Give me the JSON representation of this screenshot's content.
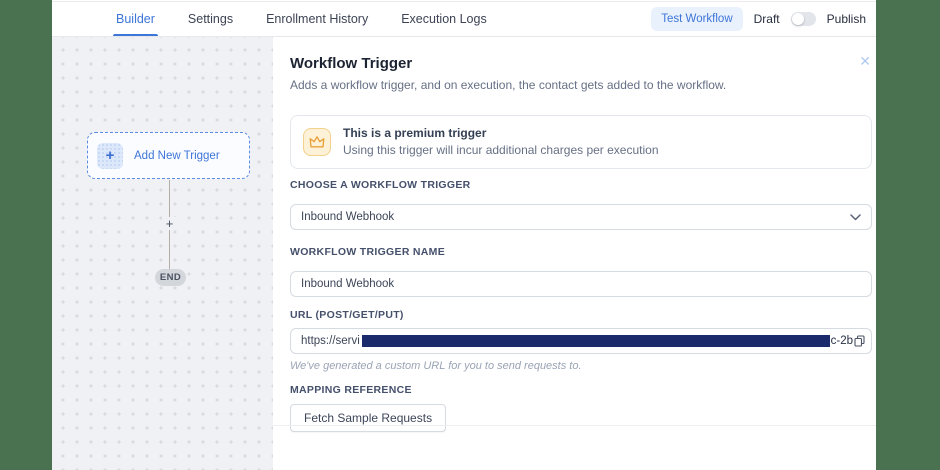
{
  "header": {
    "tabs": [
      {
        "label": "Builder"
      },
      {
        "label": "Settings"
      },
      {
        "label": "Enrollment History"
      },
      {
        "label": "Execution Logs"
      }
    ],
    "test_workflow_label": "Test Workflow",
    "draft_label": "Draft",
    "publish_label": "Publish",
    "toggle_state": "off"
  },
  "canvas": {
    "add_trigger_label": "Add New Trigger",
    "add_trigger_plus": "+",
    "connector_plus": "+",
    "end_label": "END"
  },
  "panel": {
    "title": "Workflow Trigger",
    "subtitle": "Adds a workflow trigger, and on execution, the contact gets added to the workflow.",
    "close_icon": "✕",
    "premium": {
      "icon": "crown-icon",
      "title": "This is a premium trigger",
      "subtitle": "Using this trigger will incur additional charges per execution"
    },
    "fields": {
      "trigger_label": "CHOOSE A WORKFLOW TRIGGER",
      "trigger_value": "Inbound Webhook",
      "name_label": "WORKFLOW TRIGGER NAME",
      "name_value": "Inbound Webhook",
      "url_label": "URL (POST/GET/PUT)",
      "url_prefix": "https://servi",
      "url_redacted": true,
      "url_suffix": "c-2b",
      "url_helper": "We've generated a custom URL for you to send requests to.",
      "mapping_label": "MAPPING REFERENCE",
      "fetch_button_label": "Fetch Sample Requests"
    }
  },
  "colors": {
    "accent_blue": "#3e75d8",
    "redaction_navy": "#1b2a6b",
    "edge_green": "#4a7150",
    "premium_orange": "#e9a23b",
    "canvas_gray": "#f0f1f4"
  }
}
